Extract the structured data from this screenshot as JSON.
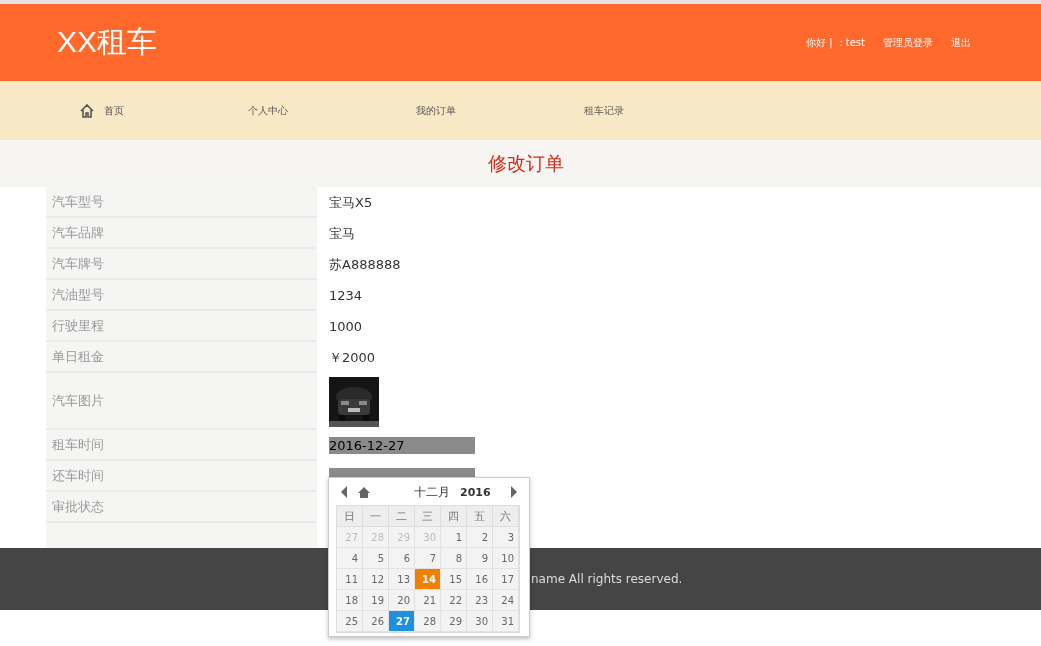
{
  "header": {
    "logo": "XX租车",
    "links": [
      "你好 | ：test",
      "管理员登录",
      "退出"
    ]
  },
  "nav": [
    {
      "label": "首页",
      "kind": "home"
    },
    {
      "label": "个人中心",
      "kind": "plain"
    },
    {
      "label": "我的订单",
      "kind": "plain"
    },
    {
      "label": "租车记录",
      "kind": "plain"
    }
  ],
  "page_title": "修改订单",
  "form": [
    {
      "label": "汽车型号",
      "kind": "text",
      "value": "宝马X5"
    },
    {
      "label": "汽车品牌",
      "kind": "text",
      "value": "宝马"
    },
    {
      "label": "汽车牌号",
      "kind": "text",
      "value": "苏A888888"
    },
    {
      "label": "汽油型号",
      "kind": "text",
      "value": "1234"
    },
    {
      "label": "行驶里程",
      "kind": "text",
      "value": "1000"
    },
    {
      "label": "单日租金",
      "kind": "text",
      "value": "￥2000"
    },
    {
      "label": "汽车图片",
      "kind": "picture"
    },
    {
      "label": "租车时间",
      "kind": "date",
      "value": "2016-12-27"
    },
    {
      "label": "还车时间",
      "kind": "date"
    },
    {
      "label": "审批状态",
      "kind": "text"
    }
  ],
  "calendar": {
    "month": "十二月",
    "year": "2016",
    "weekdays": [
      "日",
      "一",
      "二",
      "三",
      "四",
      "五",
      "六"
    ],
    "weeks": [
      [
        {
          "day": "27",
          "other_month": true,
          "selected": false,
          "hovered": false
        },
        {
          "day": "28",
          "other_month": true,
          "selected": false,
          "hovered": false
        },
        {
          "day": "29",
          "other_month": true,
          "selected": false,
          "hovered": false
        },
        {
          "day": "30",
          "other_month": true,
          "selected": false,
          "hovered": false
        },
        {
          "day": "1",
          "other_month": false,
          "selected": false,
          "hovered": false
        },
        {
          "day": "2",
          "other_month": false,
          "selected": false,
          "hovered": false
        },
        {
          "day": "3",
          "other_month": false,
          "selected": false,
          "hovered": false
        }
      ],
      [
        {
          "day": "4",
          "other_month": false,
          "selected": false,
          "hovered": false
        },
        {
          "day": "5",
          "other_month": false,
          "selected": false,
          "hovered": false
        },
        {
          "day": "6",
          "other_month": false,
          "selected": false,
          "hovered": false
        },
        {
          "day": "7",
          "other_month": false,
          "selected": false,
          "hovered": false
        },
        {
          "day": "8",
          "other_month": false,
          "selected": false,
          "hovered": false
        },
        {
          "day": "9",
          "other_month": false,
          "selected": false,
          "hovered": false
        },
        {
          "day": "10",
          "other_month": false,
          "selected": false,
          "hovered": false
        }
      ],
      [
        {
          "day": "11",
          "other_month": false,
          "selected": false,
          "hovered": false
        },
        {
          "day": "12",
          "other_month": false,
          "selected": false,
          "hovered": false
        },
        {
          "day": "13",
          "other_month": false,
          "selected": false,
          "hovered": false
        },
        {
          "day": "14",
          "other_month": false,
          "selected": false,
          "hovered": true
        },
        {
          "day": "15",
          "other_month": false,
          "selected": false,
          "hovered": false
        },
        {
          "day": "16",
          "other_month": false,
          "selected": false,
          "hovered": false
        },
        {
          "day": "17",
          "other_month": false,
          "selected": false,
          "hovered": false
        }
      ],
      [
        {
          "day": "18",
          "other_month": false,
          "selected": false,
          "hovered": false
        },
        {
          "day": "19",
          "other_month": false,
          "selected": false,
          "hovered": false
        },
        {
          "day": "20",
          "other_month": false,
          "selected": false,
          "hovered": false
        },
        {
          "day": "21",
          "other_month": false,
          "selected": false,
          "hovered": false
        },
        {
          "day": "22",
          "other_month": false,
          "selected": false,
          "hovered": false
        },
        {
          "day": "23",
          "other_month": false,
          "selected": false,
          "hovered": false
        },
        {
          "day": "24",
          "other_month": false,
          "selected": false,
          "hovered": false
        }
      ],
      [
        {
          "day": "25",
          "other_month": false,
          "selected": false,
          "hovered": false
        },
        {
          "day": "26",
          "other_month": false,
          "selected": false,
          "hovered": false
        },
        {
          "day": "27",
          "other_month": false,
          "selected": true,
          "hovered": false
        },
        {
          "day": "28",
          "other_month": false,
          "selected": false,
          "hovered": false
        },
        {
          "day": "29",
          "other_month": false,
          "selected": false,
          "hovered": false
        },
        {
          "day": "30",
          "other_month": false,
          "selected": false,
          "hovered": false
        },
        {
          "day": "31",
          "other_month": false,
          "selected": false,
          "hovered": false
        }
      ]
    ]
  },
  "footer": {
    "text": "name All rights reserved."
  }
}
